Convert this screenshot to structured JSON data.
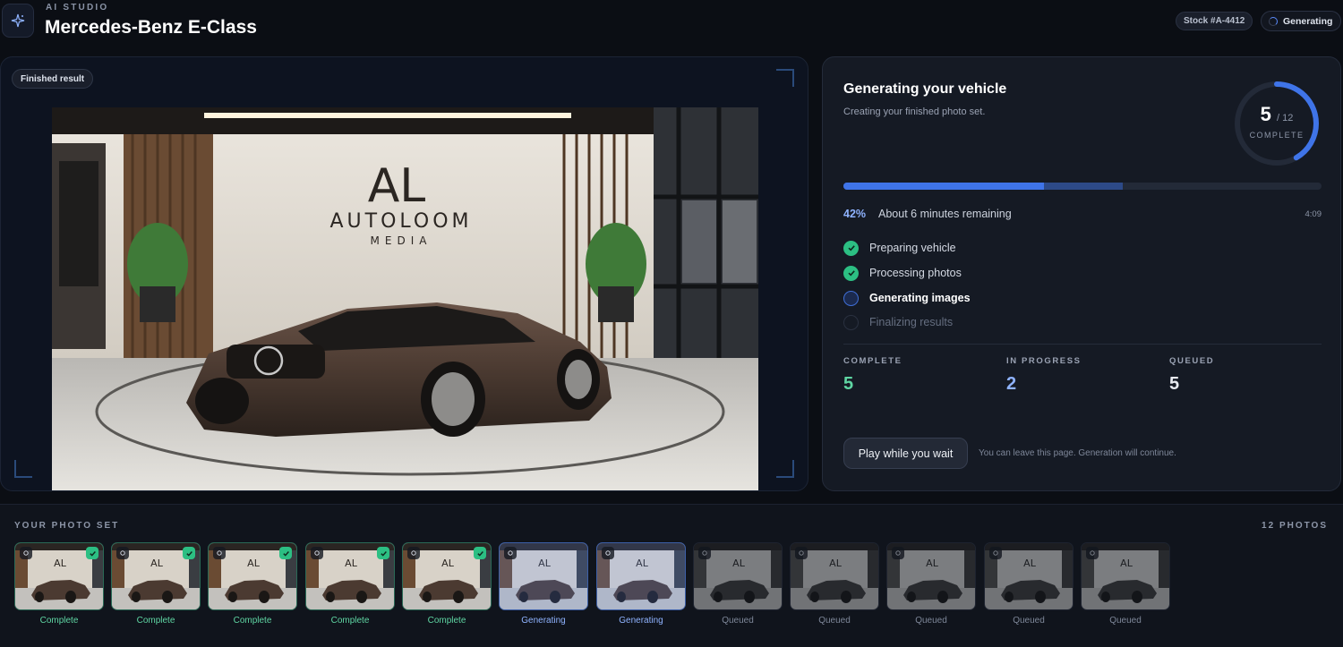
{
  "header": {
    "eyebrow": "AI STUDIO",
    "title": "Mercedes-Benz E-Class",
    "stock": "Stock #A-4412",
    "status": "Generating"
  },
  "preview": {
    "badge": "Finished result",
    "brand_line1": "AUTOLOOM",
    "brand_line2": "MEDIA"
  },
  "progress": {
    "title": "Generating your vehicle",
    "subtitle": "Creating your finished photo set.",
    "done_count": "5",
    "total_label": "/ 12",
    "ring_label": "COMPLETE",
    "percent": 42,
    "percent_label": "42%",
    "remaining": "About 6 minutes remaining",
    "elapsed": "4:09",
    "steps": [
      {
        "label": "Preparing vehicle",
        "state": "done"
      },
      {
        "label": "Processing photos",
        "state": "done"
      },
      {
        "label": "Generating images",
        "state": "active"
      },
      {
        "label": "Finalizing results",
        "state": "pending"
      }
    ],
    "stats": {
      "complete_label": "COMPLETE",
      "complete_value": "5",
      "progress_label": "IN PROGRESS",
      "progress_value": "2",
      "queued_label": "QUEUED",
      "queued_value": "5"
    },
    "play_button": "Play while you wait",
    "note": "You can leave this page. Generation will continue."
  },
  "photo_set": {
    "title": "YOUR PHOTO SET",
    "count": "12 PHOTOS",
    "items": [
      {
        "status": "Complete",
        "state": "complete",
        "icon": "gear-icon"
      },
      {
        "status": "Complete",
        "state": "complete",
        "icon": "gear-icon"
      },
      {
        "status": "Complete",
        "state": "complete",
        "icon": "gear-icon"
      },
      {
        "status": "Complete",
        "state": "complete",
        "icon": "wand-icon"
      },
      {
        "status": "Complete",
        "state": "complete",
        "icon": "gear-icon"
      },
      {
        "status": "Generating",
        "state": "generating",
        "icon": "gear-icon"
      },
      {
        "status": "Generating",
        "state": "generating",
        "icon": "gear-icon"
      },
      {
        "status": "Queued",
        "state": "queued",
        "icon": "wand-icon"
      },
      {
        "status": "Queued",
        "state": "queued",
        "icon": "gear-icon"
      },
      {
        "status": "Queued",
        "state": "queued",
        "icon": "gear-icon"
      },
      {
        "status": "Queued",
        "state": "queued",
        "icon": "gear-icon"
      },
      {
        "status": "Queued",
        "state": "queued",
        "icon": "wand-icon"
      }
    ]
  },
  "colors": {
    "accent": "#3f74e8",
    "complete": "#2cbf83",
    "complete_text": "#5fd6a3",
    "generating_text": "#8fb3ff",
    "queued_text": "#7e8799"
  }
}
